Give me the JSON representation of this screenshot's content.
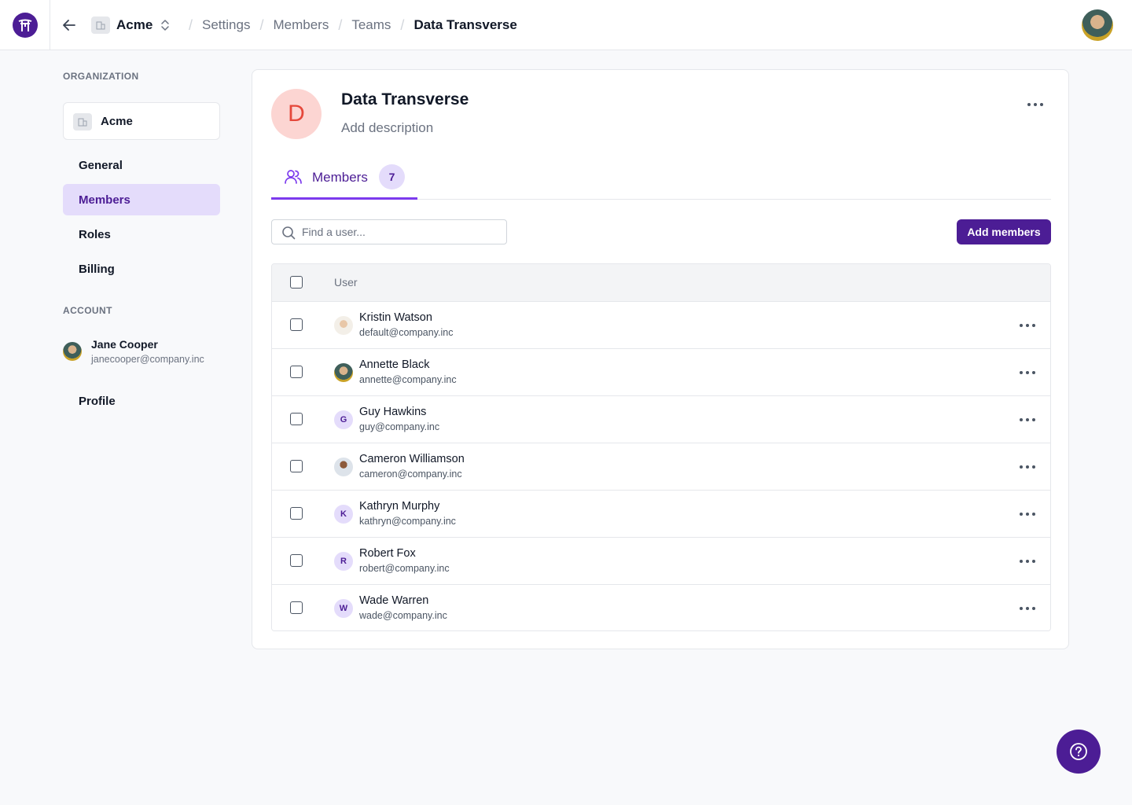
{
  "breadcrumb": {
    "org": "Acme",
    "items": [
      "Settings",
      "Members",
      "Teams"
    ],
    "current": "Data Transverse"
  },
  "sidebar": {
    "org_heading": "ORGANIZATION",
    "org_name": "Acme",
    "items": [
      {
        "label": "General"
      },
      {
        "label": "Members"
      },
      {
        "label": "Roles"
      },
      {
        "label": "Billing"
      }
    ],
    "account_heading": "ACCOUNT",
    "account": {
      "name": "Jane Cooper",
      "email": "janecooper@company.inc"
    },
    "profile_label": "Profile"
  },
  "team": {
    "initial": "D",
    "title": "Data Transverse",
    "description_placeholder": "Add description"
  },
  "tab": {
    "label": "Members",
    "count": "7"
  },
  "search": {
    "placeholder": "Find a user..."
  },
  "add_button": "Add members",
  "table": {
    "header": "User",
    "rows": [
      {
        "name": "Kristin Watson",
        "email": "default@company.inc",
        "avatar": "photo1",
        "initial": ""
      },
      {
        "name": "Annette Black",
        "email": "annette@company.inc",
        "avatar": "photo2",
        "initial": ""
      },
      {
        "name": "Guy Hawkins",
        "email": "guy@company.inc",
        "avatar": "letter",
        "initial": "G"
      },
      {
        "name": "Cameron Williamson",
        "email": "cameron@company.inc",
        "avatar": "photo3",
        "initial": ""
      },
      {
        "name": "Kathryn Murphy",
        "email": "kathryn@company.inc",
        "avatar": "letter",
        "initial": "K"
      },
      {
        "name": "Robert Fox",
        "email": "robert@company.inc",
        "avatar": "letter",
        "initial": "R"
      },
      {
        "name": "Wade Warren",
        "email": "wade@company.inc",
        "avatar": "letter",
        "initial": "W"
      }
    ]
  },
  "colors": {
    "accent": "#4c1d95",
    "accent_light": "#e4dcfb",
    "team_avatar_bg": "#fcd5d2",
    "team_avatar_fg": "#e5483b"
  },
  "icons": [
    "logo-icon",
    "back-arrow-icon",
    "building-icon",
    "chevron-updown-icon",
    "users-icon",
    "search-icon",
    "more-horizontal-icon",
    "help-icon"
  ]
}
